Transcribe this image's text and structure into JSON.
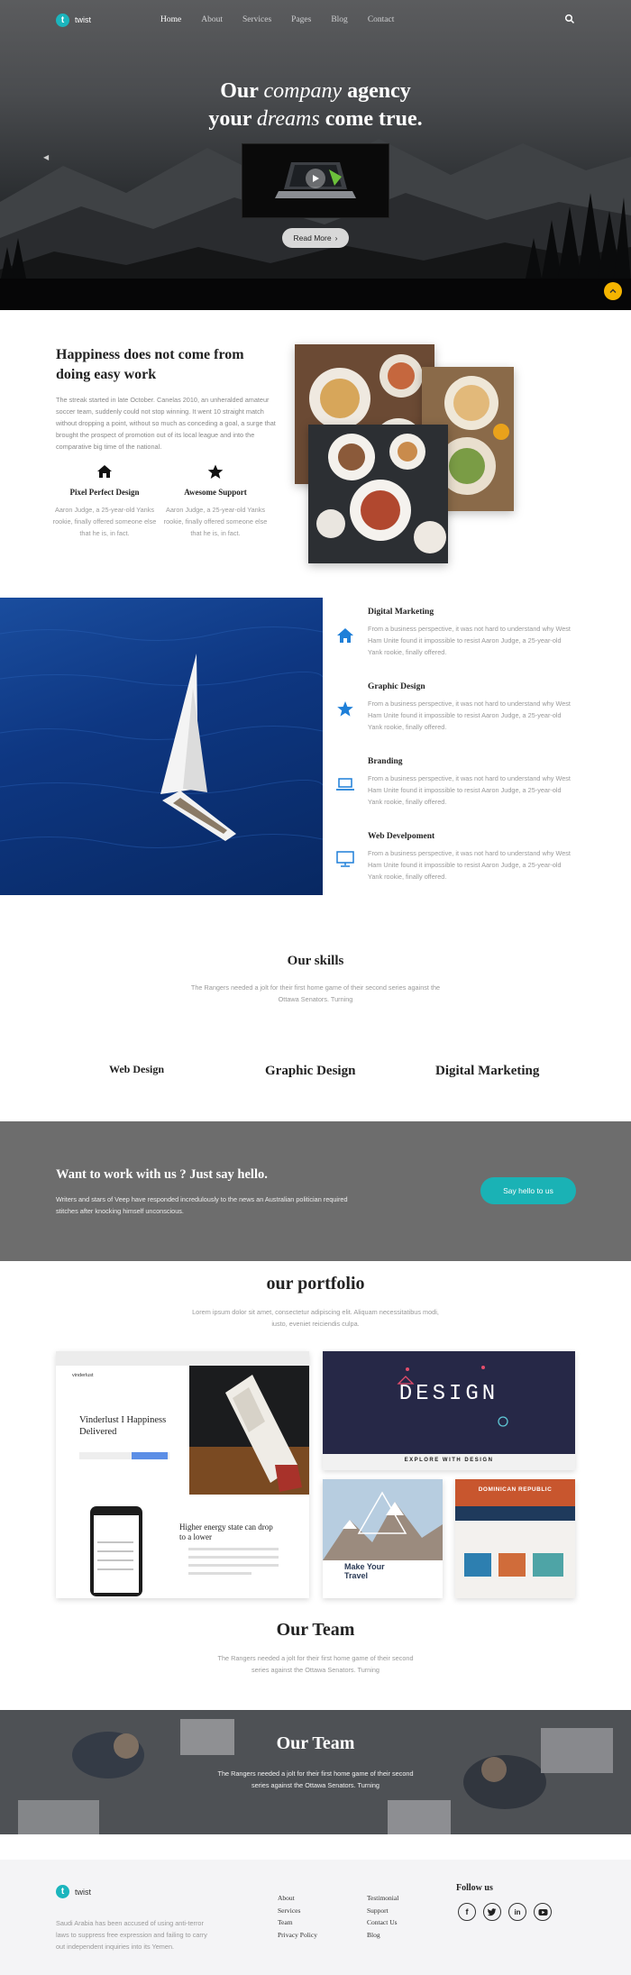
{
  "brand": {
    "name": "twist",
    "badge": "t"
  },
  "nav": {
    "items": [
      "Home",
      "About",
      "Services",
      "Pages",
      "Blog",
      "Contact"
    ],
    "active": "Home"
  },
  "hero": {
    "line1_pre": "Our ",
    "line1_em": "company",
    "line1_post": " agency",
    "line2_pre": "your ",
    "line2_em": "dreams",
    "line2_post": " come true.",
    "button": "Read More"
  },
  "intro": {
    "title": "Happiness does not come from doing easy work",
    "text": "The streak started in late October. Canelas 2010, an unheralded amateur soccer team, suddenly could not stop winning. It went 10 straight match without dropping a point, without so much as conceding a goal, a surge that brought the prospect of promotion out of its local league and into the comparative big time of the national.",
    "features": [
      {
        "icon": "home-icon",
        "title": "Pixel Perfect Design",
        "text": "Aaron Judge, a 25-year-old Yanks rookie, finally offered someone else that he is, in fact."
      },
      {
        "icon": "star-icon",
        "title": "Awesome Support",
        "text": "Aaron Judge, a 25-year-old Yanks rookie, finally offered someone else that he is, in fact."
      }
    ]
  },
  "services": [
    {
      "icon": "home-icon",
      "title": "Digital Marketing",
      "text": "From a business perspective, it was not hard to understand why West Ham Unite found it impossible to resist Aaron Judge, a 25-year-old Yank rookie, finally offered."
    },
    {
      "icon": "star-icon",
      "title": "Graphic Design",
      "text": "From a business perspective, it was not hard to understand why West Ham Unite found it impossible to resist Aaron Judge, a 25-year-old Yank rookie, finally offered."
    },
    {
      "icon": "laptop-icon",
      "title": "Branding",
      "text": "From a business perspective, it was not hard to understand why West Ham Unite found it impossible to resist Aaron Judge, a 25-year-old Yank rookie, finally offered."
    },
    {
      "icon": "monitor-icon",
      "title": "Web Develpoment",
      "text": "From a business perspective, it was not hard to understand why West Ham Unite found it impossible to resist Aaron Judge, a 25-year-old Yank rookie, finally offered."
    }
  ],
  "skills": {
    "title": "Our skills",
    "subtitle": "The Rangers needed a jolt for their first home game of their second series against the Ottawa Senators. Turning",
    "items": [
      "Web Design",
      "Graphic Design",
      "Digital Marketing"
    ]
  },
  "cta": {
    "title": "Want to work with us ? Just say hello.",
    "text": "Writers and stars of Veep have responded incredulously to the news an Australian politician required stitches after knocking himself unconscious.",
    "button": "Say hello to us"
  },
  "portfolio": {
    "title": "our portfolio",
    "subtitle": "Lorem ipsum dolor sit amet, consectetur adipiscing elit. Aliquam necessitatibus modi, iusto, eveniet reiciendis culpa.",
    "card1": {
      "brand": "vinderlust",
      "headline": "Vinderlust I Happiness Delivered",
      "tagline": "Higher energy state can drop to a lower"
    },
    "card2": {
      "title": "DESIGN",
      "caption": "EXPLORE WITH DESIGN"
    },
    "card3": {
      "text": "Make Your Travel"
    },
    "card4": {
      "title": "DOMINICAN REPUBLIC"
    }
  },
  "team": {
    "title": "Our Team",
    "subtitle": "The Rangers needed a jolt for their first home game of their second series against the Ottawa Senators. Turning"
  },
  "team_banner": {
    "title": "Our Team",
    "subtitle": "The Rangers needed a jolt for their first home game of their second series against the Ottawa Senators. Turning"
  },
  "footer": {
    "brand": "twist",
    "text": "Saudi Arabia has been accused of using anti-terror laws to suppress free expression and failing to carry out independent inquiries into its Yemen.",
    "links_col1": [
      "About",
      "Services",
      "Team",
      "Privacy Policy"
    ],
    "links_col2": [
      "Testimonial",
      "Support",
      "Contact Us",
      "Blog"
    ],
    "follow_title": "Follow us",
    "social": [
      "f",
      "t",
      "in",
      "yt"
    ]
  },
  "colors": {
    "accent": "#1ab2b5",
    "yellow": "#f5b400",
    "blue_icon": "#1e7fd8",
    "cta_bg": "#6d6d6d"
  }
}
